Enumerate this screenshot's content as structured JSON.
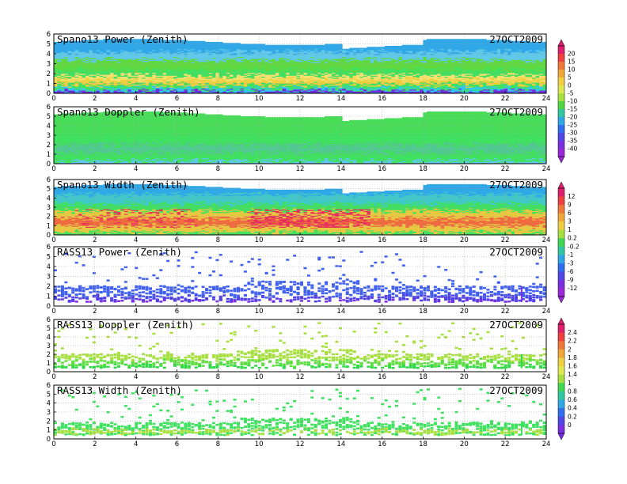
{
  "chart_data": [
    {
      "type": "heatmap",
      "title": "Spano13 Power (Zenith)",
      "date": "27OCT2009",
      "xlim": [
        0,
        24
      ],
      "ylim": [
        0,
        6
      ],
      "xticks": [
        0,
        2,
        4,
        6,
        8,
        10,
        12,
        14,
        16,
        18,
        20,
        22,
        24
      ],
      "yticks": [
        0,
        1,
        2,
        3,
        4,
        5,
        6
      ],
      "grid": true,
      "colorbar_id": "cb1",
      "coverage": "dense",
      "profile": [
        [
          0.2,
          "#7030e0"
        ],
        [
          0.5,
          "#30c8f0"
        ],
        [
          0.9,
          "#40e060"
        ],
        [
          1.4,
          "#f0d040"
        ],
        [
          1.8,
          "#f5e070"
        ],
        [
          2.4,
          "#40e060"
        ],
        [
          3.4,
          "#60d840"
        ],
        [
          4.2,
          "#60c8e8"
        ],
        [
          5.2,
          "#30a8e8"
        ]
      ]
    },
    {
      "type": "heatmap",
      "title": "Spano13 Doppler (Zenith)",
      "date": "27OCT2009",
      "xlim": [
        0,
        24
      ],
      "ylim": [
        0,
        6
      ],
      "xticks": [
        0,
        2,
        4,
        6,
        8,
        10,
        12,
        14,
        16,
        18,
        20,
        22,
        24
      ],
      "yticks": [
        0,
        1,
        2,
        3,
        4,
        5,
        6
      ],
      "grid": true,
      "colorbar_id": "cb1",
      "coverage": "dense",
      "profile": [
        [
          0.3,
          "#60c8f0"
        ],
        [
          1.2,
          "#40e060"
        ],
        [
          2.0,
          "#50c890"
        ],
        [
          3.2,
          "#40e060"
        ],
        [
          5.2,
          "#48dc58"
        ]
      ]
    },
    {
      "type": "heatmap",
      "title": "Spano13 Width (Zenith)",
      "date": "27OCT2009",
      "xlim": [
        0,
        24
      ],
      "ylim": [
        0,
        6
      ],
      "xticks": [
        0,
        2,
        4,
        6,
        8,
        10,
        12,
        14,
        16,
        18,
        20,
        22,
        24
      ],
      "yticks": [
        0,
        1,
        2,
        3,
        4,
        5,
        6
      ],
      "grid": true,
      "colorbar_id": "cb2",
      "coverage": "dense",
      "profile": [
        [
          0.3,
          "#40e060"
        ],
        [
          1.0,
          "#e8c840"
        ],
        [
          1.8,
          "#f06a40"
        ],
        [
          2.6,
          "#e8c840"
        ],
        [
          3.4,
          "#40e060"
        ],
        [
          4.4,
          "#40c8c8"
        ],
        [
          5.2,
          "#30a8e8"
        ]
      ]
    },
    {
      "type": "heatmap",
      "title": "RASS13 Power (Zenith)",
      "date": "27OCT2009",
      "xlim": [
        0,
        24
      ],
      "ylim": [
        0,
        6
      ],
      "xticks": [
        0,
        2,
        4,
        6,
        8,
        10,
        12,
        14,
        16,
        18,
        20,
        22,
        24
      ],
      "yticks": [
        0,
        1,
        2,
        3,
        4,
        5,
        6
      ],
      "grid": true,
      "colorbar_id": "cb2",
      "coverage": "sparse",
      "band": [
        0.4,
        1.8
      ],
      "profile": [
        [
          0.5,
          "#7a30e0"
        ],
        [
          1.0,
          "#5040e8"
        ],
        [
          1.8,
          "#4060f0"
        ]
      ]
    },
    {
      "type": "heatmap",
      "title": "RASS13 Doppler (Zenith)",
      "date": "27OCT2009",
      "xlim": [
        0,
        24
      ],
      "ylim": [
        0,
        6
      ],
      "xticks": [
        0,
        2,
        4,
        6,
        8,
        10,
        12,
        14,
        16,
        18,
        20,
        22,
        24
      ],
      "yticks": [
        0,
        1,
        2,
        3,
        4,
        5,
        6
      ],
      "grid": true,
      "colorbar_id": "cb3",
      "coverage": "sparse",
      "band": [
        0.4,
        1.8
      ],
      "profile": [
        [
          0.7,
          "#30d848"
        ],
        [
          1.3,
          "#60e040"
        ],
        [
          1.8,
          "#a8e040"
        ]
      ]
    },
    {
      "type": "heatmap",
      "title": "RASS13 Width (Zenith)",
      "date": "27OCT2009",
      "xlim": [
        0,
        24
      ],
      "ylim": [
        0,
        6
      ],
      "xticks": [
        0,
        2,
        4,
        6,
        8,
        10,
        12,
        14,
        16,
        18,
        20,
        22,
        24
      ],
      "yticks": [
        0,
        1,
        2,
        3,
        4,
        5,
        6
      ],
      "grid": true,
      "colorbar_id": "cb3",
      "coverage": "sparse",
      "band": [
        0.4,
        1.6
      ],
      "profile": [
        [
          0.6,
          "#40e060"
        ],
        [
          1.0,
          "#a8e040"
        ],
        [
          1.6,
          "#40e060"
        ]
      ]
    }
  ],
  "colorbars": [
    {
      "id": "cb1",
      "ticks": [
        "20",
        "15",
        "10",
        "5",
        "0",
        "-5",
        "-10",
        "-15",
        "-20",
        "-25",
        "-30",
        "-35",
        "-40"
      ],
      "colors": [
        "#e0206e",
        "#f04040",
        "#f07838",
        "#f0a838",
        "#f0d040",
        "#e0e850",
        "#a8e040",
        "#50d840",
        "#30c8a0",
        "#30a8e8",
        "#3070f0",
        "#5048e8",
        "#7a30e0",
        "#9a28d8"
      ]
    },
    {
      "id": "cb2",
      "ticks": [
        "12",
        "9",
        "6",
        "3",
        "1",
        "0.2",
        "-0.2",
        "-1",
        "-3",
        "-6",
        "-9",
        "-12"
      ],
      "colors": [
        "#e0206e",
        "#f04040",
        "#f07838",
        "#f0a838",
        "#f0d040",
        "#a8e040",
        "#40d850",
        "#30c8a0",
        "#30a8e8",
        "#3070f0",
        "#5048e8",
        "#7a30e0",
        "#9a28d8"
      ]
    },
    {
      "id": "cb3",
      "ticks": [
        "2.4",
        "2.2",
        "2",
        "1.8",
        "1.6",
        "1.4",
        "1",
        "0.8",
        "0.6",
        "0.4",
        "0.2",
        "0"
      ],
      "colors": [
        "#e0206e",
        "#f04040",
        "#f07838",
        "#f0a838",
        "#f0d040",
        "#e0e850",
        "#a8e040",
        "#40d850",
        "#30c8a0",
        "#30a8e8",
        "#3070f0",
        "#5048e8",
        "#7a30e0"
      ]
    }
  ]
}
